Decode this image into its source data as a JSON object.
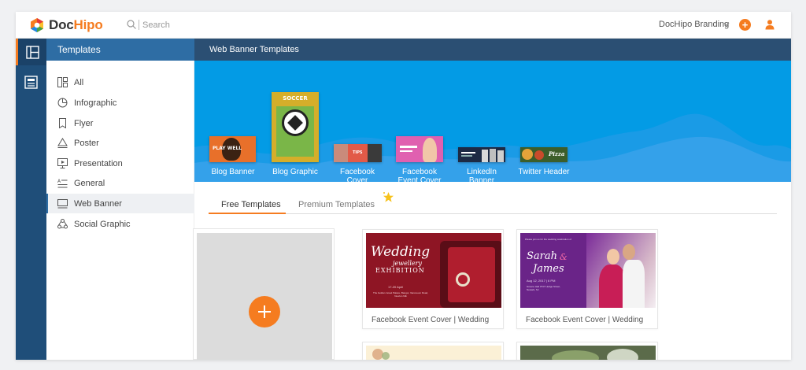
{
  "app": {
    "name_part1": "Doc",
    "name_part2": "Hipo",
    "accent_color": "#f57c20",
    "brand_blue": "#1f4e79"
  },
  "topbar": {
    "search_placeholder": "Search",
    "account_label": "DocHipo Branding",
    "add_label": "+"
  },
  "sidebar": {
    "header": "Templates",
    "items": [
      {
        "label": "All",
        "icon": "grid-layout-icon",
        "active": false
      },
      {
        "label": "Infographic",
        "icon": "pie-chart-icon",
        "active": false
      },
      {
        "label": "Flyer",
        "icon": "flyer-icon",
        "active": false
      },
      {
        "label": "Poster",
        "icon": "triangle-poster-icon",
        "active": false
      },
      {
        "label": "Presentation",
        "icon": "presentation-icon",
        "active": false
      },
      {
        "label": "General",
        "icon": "text-lines-icon",
        "active": false
      },
      {
        "label": "Web Banner",
        "icon": "monitor-icon",
        "active": true
      },
      {
        "label": "Social Graphic",
        "icon": "social-icon",
        "active": false
      }
    ]
  },
  "main": {
    "header": "Web Banner Templates",
    "categories": [
      {
        "label": "Blog Banner"
      },
      {
        "label": "Blog Graphic"
      },
      {
        "label": "Facebook Cover"
      },
      {
        "label": "Facebook Event Cover"
      },
      {
        "label": "LinkedIn Banner"
      },
      {
        "label": "Twitter Header"
      }
    ],
    "tabs": [
      {
        "label": "Free Templates",
        "active": true
      },
      {
        "label": "Premium Templates",
        "active": false
      }
    ],
    "cards": [
      {
        "label": "Facebook Event Cover | Wedding"
      },
      {
        "label": "Facebook Event Cover | Wedding"
      }
    ],
    "card1_text": {
      "title1": "Wedding",
      "title2": "jewellery",
      "title3": "EXHIBITION",
      "date": "17-20 April",
      "address": "The Golden Jewel Palace, Bangor, Vancouver Road, Newton ME"
    },
    "card2_text": {
      "invite": "Please join us for the wedding celebration of",
      "name1": "Sarah",
      "amp": "&",
      "name2": "James",
      "date": "Aug 12, 2017 | 6 PM",
      "venue": "Greene Hall 3747 Hedge Street, Newark, NJ"
    },
    "thumb_text": {
      "soccer": "SOCCER",
      "tips": "TIPS",
      "pizza": "Pizza",
      "blog": "PLAY WELL"
    }
  }
}
